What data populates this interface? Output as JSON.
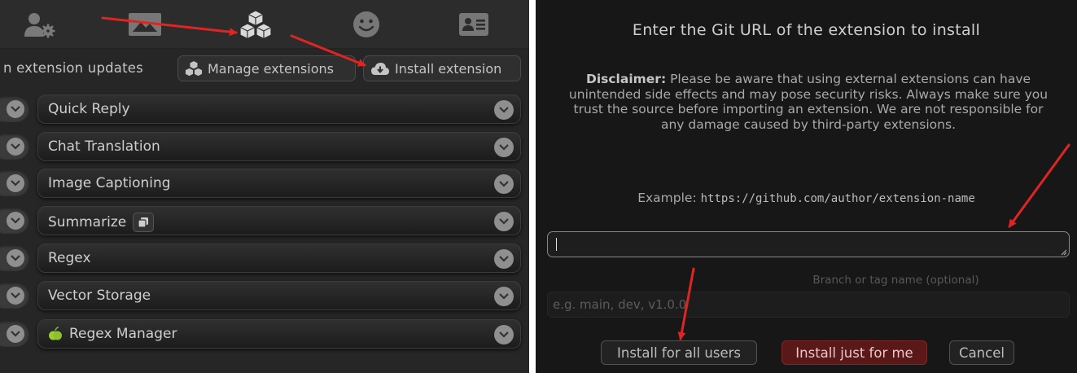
{
  "left_panel": {
    "top_icons": [
      {
        "name": "user-settings-icon",
        "active": false
      },
      {
        "name": "background-icon",
        "active": false
      },
      {
        "name": "extensions-cubes-icon",
        "active": true
      },
      {
        "name": "smiley-icon",
        "active": false
      },
      {
        "name": "persona-card-icon",
        "active": false
      }
    ],
    "toolbar": {
      "updates_text": "n extension updates",
      "manage_label": "Manage extensions",
      "install_label": "Install extension"
    },
    "extensions": [
      {
        "label": "Quick Reply"
      },
      {
        "label": "Chat Translation"
      },
      {
        "label": "Image Captioning"
      },
      {
        "label": "Summarize"
      },
      {
        "label": "Regex"
      },
      {
        "label": "Vector Storage"
      },
      {
        "label": "Regex Manager"
      }
    ]
  },
  "dialog": {
    "title": "Enter the Git URL of the extension to install",
    "disclaimer_bold": "Disclaimer:",
    "disclaimer_text": "Please be aware that using external extensions can have unintended side effects and may pose security risks. Always make sure you trust the source before importing an extension. We are not responsible for any damage caused by third-party extensions.",
    "example_label": "Example:",
    "example_url": "https://github.com/author/extension-name",
    "url_value": "",
    "branch_label": "Branch or tag name (optional)",
    "branch_placeholder": "e.g. main, dev, v1.0.0",
    "buttons": {
      "all_users": "Install for all users",
      "just_me": "Install just for me",
      "cancel": "Cancel"
    }
  },
  "colors": {
    "annotation_arrow": "#e02424",
    "danger_button": "#5a1818"
  }
}
